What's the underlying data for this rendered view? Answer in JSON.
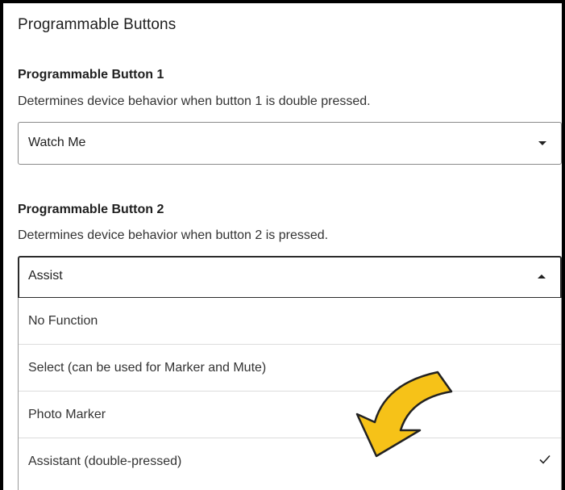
{
  "section": {
    "title": "Programmable Buttons"
  },
  "button1": {
    "title": "Programmable Button 1",
    "description": "Determines device behavior when button 1 is double pressed.",
    "value": "Watch Me"
  },
  "button2": {
    "title": "Programmable Button 2",
    "description": "Determines device behavior when button 2 is pressed.",
    "value": "Assist",
    "options": [
      {
        "label": "No Function"
      },
      {
        "label": "Select (can be used for Marker and Mute)"
      },
      {
        "label": "Photo Marker"
      },
      {
        "label": "Assistant (double-pressed)",
        "selected": true
      }
    ]
  },
  "icons": {
    "dropdown_closed": "chevron-down-icon",
    "dropdown_open": "chevron-up-icon",
    "selected": "checkmark-icon",
    "annotation": "curved-arrow-icon"
  },
  "colors": {
    "annotation_fill": "#f6c218",
    "annotation_stroke": "#222222"
  }
}
